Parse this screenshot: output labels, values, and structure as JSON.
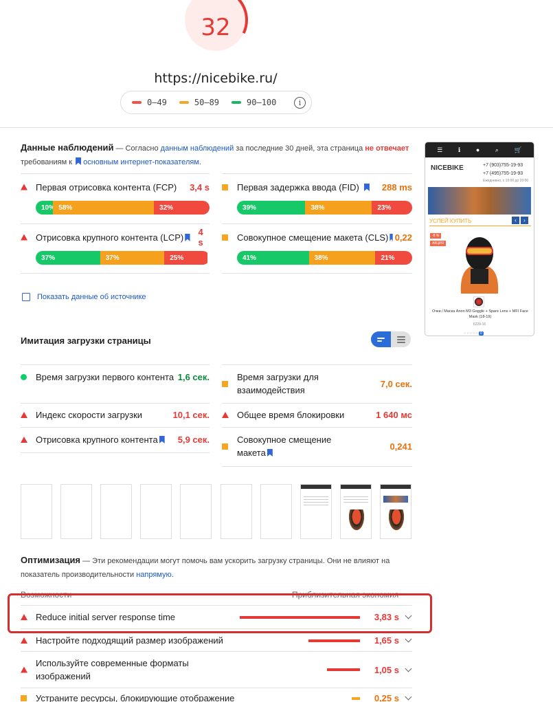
{
  "report": {
    "score": "32",
    "score_color": "#e53935",
    "url": "https://nicebike.ru/",
    "legend": [
      {
        "range": "0–49",
        "color": "#ee5448"
      },
      {
        "range": "50–89",
        "color": "#f5a623"
      },
      {
        "range": "90–100",
        "color": "#18b663"
      }
    ],
    "legend_info_icon": "i"
  },
  "field_data": {
    "title": "Данные наблюдений",
    "intro_1": " — Согласно ",
    "intro_link": "данным наблюдений",
    "intro_2": " за последние 30 дней, эта страница ",
    "intro_bad": "не отвечает",
    "intro_3": " требованиям к ",
    "intro_link2": "основным интернет-показателям",
    "intro_4": ".",
    "metrics": [
      {
        "label": "Первая отрисовка контента (FCP)",
        "value": "3,4 s",
        "status": "bad",
        "dist": [
          "10%",
          "58%",
          "32%"
        ],
        "dist_values": [
          10,
          58,
          32
        ]
      },
      {
        "label": "Первая задержка ввода (FID)",
        "value": "288 ms",
        "status": "average",
        "dist": [
          "39%",
          "38%",
          "23%"
        ],
        "dist_values": [
          39,
          38,
          23
        ]
      },
      {
        "label": "Отрисовка крупного контента (LCP)",
        "value": "4 s",
        "status": "bad",
        "dist": [
          "37%",
          "37%",
          "25%"
        ],
        "dist_values": [
          37,
          37,
          25
        ]
      },
      {
        "label": "Совокупное смещение макета (CLS)",
        "value": "0,22",
        "status": "average",
        "dist": [
          "41%",
          "38%",
          "21%"
        ],
        "dist_values": [
          41,
          38,
          21
        ]
      }
    ],
    "origin_toggle": "Показать данные об источнике"
  },
  "phone": {
    "logo": "NICEBIKE",
    "phone1": "+7 (903)755-19-93",
    "phone2": "+7 (495)755-19-93",
    "hours": "Ежедневно, с 10:00 до 20:00",
    "sale_title": "УСПЕЙ КУПИТЬ",
    "badge_discount": "-8 %",
    "badge_action": "АКЦИЯ",
    "product": "Очки / Маска Anon M3 Goggle + Spare Lens + MFI Face Mask (18-19)",
    "code": "6229-16",
    "cart_count": "0"
  },
  "lab_data": {
    "title": "Имитация загрузки страницы",
    "metrics": [
      {
        "label": "Время загрузки первого контента",
        "value": "1,6 сек.",
        "status": "good"
      },
      {
        "label": "Время загрузки для взаимодействия",
        "value": "7,0 сек.",
        "status": "average"
      },
      {
        "label": "Индекс скорости загрузки",
        "value": "10,1 сек.",
        "status": "bad"
      },
      {
        "label": "Общее время блокировки",
        "value": "1 640 мс",
        "status": "bad"
      },
      {
        "label": "Отрисовка крупного контента",
        "value": "5,9 сек.",
        "status": "bad"
      },
      {
        "label": "Совокупное смещение макета",
        "value": "0,241",
        "status": "average"
      }
    ]
  },
  "optimization": {
    "title": "Оптимизация",
    "intro": " — Эти рекомендации могут помочь вам ускорить загрузку страницы. Они не влияют на показатель производительности ",
    "intro_link": "напрямую",
    "intro_end": ".",
    "col_left": "Возможности",
    "col_right": "Приблизительная экономия",
    "items": [
      {
        "label": "Reduce initial server response time",
        "value": "3,83 s",
        "savings": 3.83,
        "status": "bad"
      },
      {
        "label": "Настройте подходящий размер изображений",
        "value": "1,65 s",
        "savings": 1.65,
        "status": "bad"
      },
      {
        "label": "Используйте современные форматы изображений",
        "value": "1,05 s",
        "savings": 1.05,
        "status": "bad"
      },
      {
        "label": "Устраните ресурсы, блокирующие отображение",
        "value": "0,25 s",
        "savings": 0.25,
        "status": "average"
      }
    ]
  },
  "colors": {
    "bad": "#e53935",
    "average": "#e8710a",
    "good": "#0b8a3e",
    "bar_good": "#16c867",
    "bar_avg": "#f5a11d",
    "bar_bad": "#f0493d"
  }
}
